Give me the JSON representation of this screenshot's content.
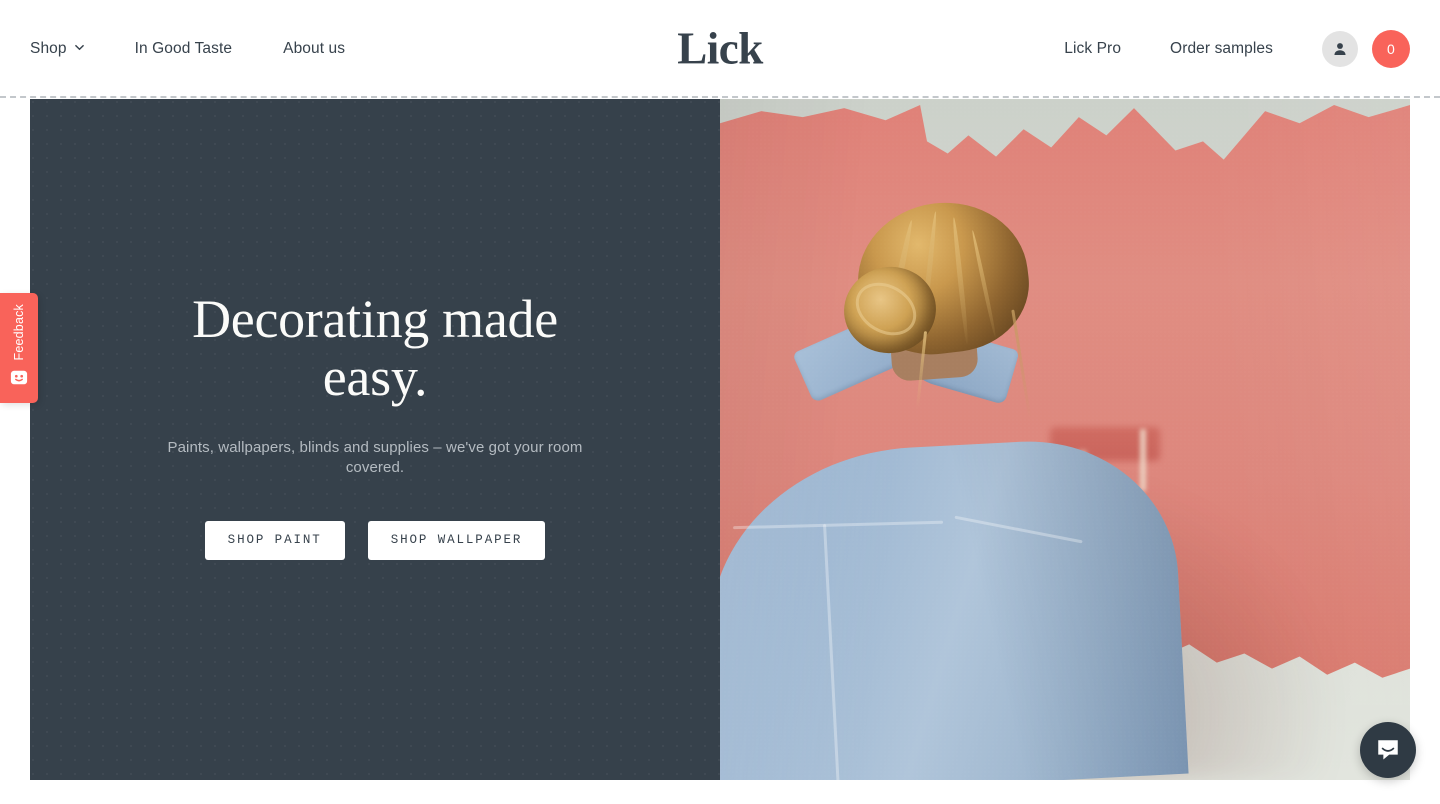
{
  "header": {
    "logo": "Lick",
    "nav_left": [
      {
        "label": "Shop",
        "has_dropdown": true
      },
      {
        "label": "In Good Taste",
        "has_dropdown": false
      },
      {
        "label": "About us",
        "has_dropdown": false
      }
    ],
    "nav_right": [
      {
        "label": "Lick Pro"
      },
      {
        "label": "Order samples"
      }
    ],
    "account_icon": "person-icon",
    "cart_icon": "cart-badge",
    "cart_count": "0"
  },
  "hero": {
    "title": "Decorating made easy.",
    "subtitle": "Paints, wallpapers, blinds and supplies – we've got your room covered.",
    "cta_primary": "SHOP PAINT",
    "cta_secondary": "SHOP WALLPAPER",
    "image_alt": "Woman in a denim jacket with blonde hair in a bun using a paint roller to paint a wall coral pink over pale grey"
  },
  "feedback": {
    "label": "Feedback",
    "icon": "smiley-face-icon"
  },
  "chat": {
    "icon": "chat-bubble-icon"
  },
  "colors": {
    "brand_coral": "#f9635a",
    "dark_slate": "#36414b",
    "paint_coral": "#e08d82",
    "wall_grey": "#d6dad2",
    "denim_blue": "#9cb6d1",
    "text_dark": "#37424c",
    "subtitle_grey": "#b4bbc1",
    "avatar_grey": "#e3e3e3",
    "chat_dark": "#2f3a44"
  }
}
